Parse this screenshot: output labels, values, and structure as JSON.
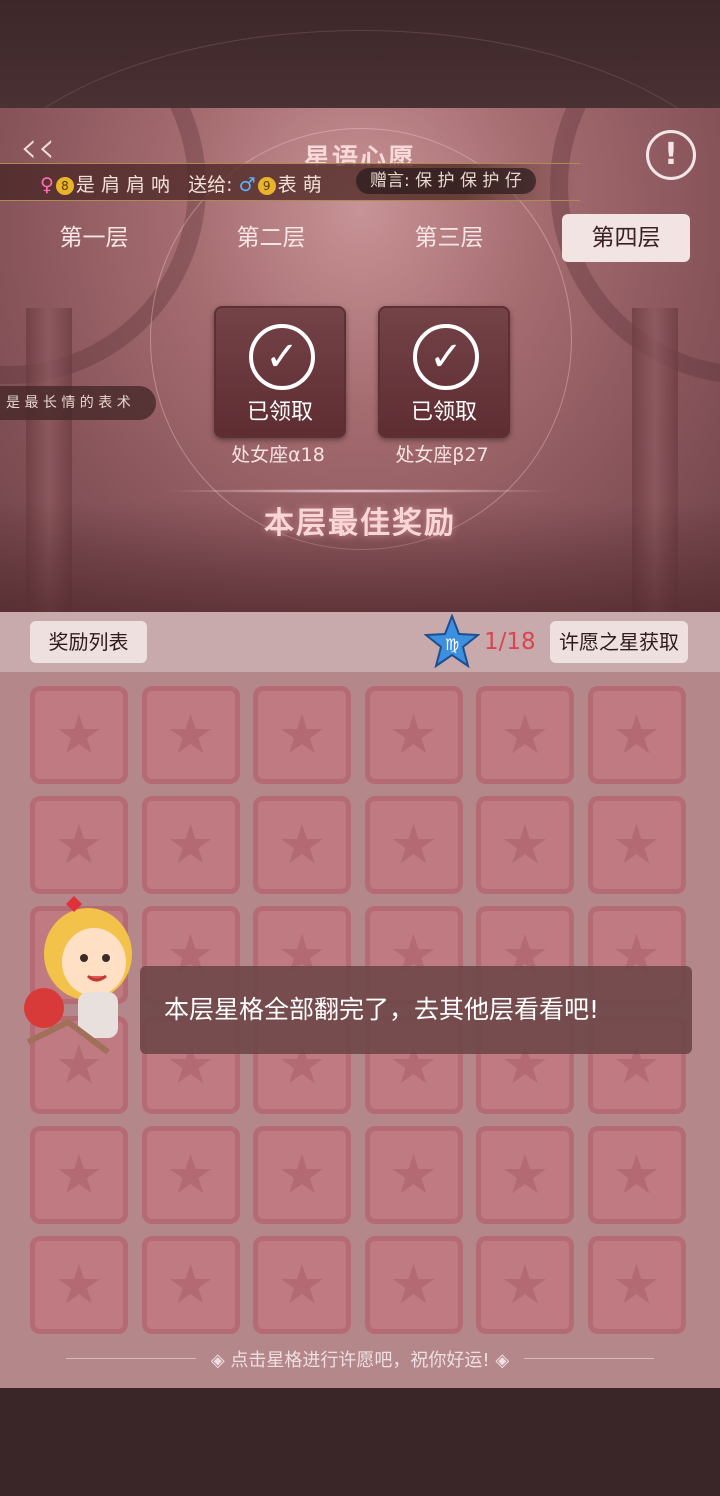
{
  "header": {
    "title": "星语心愿",
    "back_icon": "chevron-left-icon",
    "info_icon": "info-icon"
  },
  "gift_banner": {
    "sender_level": "8",
    "sender_name": "是 肩 肩 呐",
    "sent_to_label": "送给:",
    "receiver_level": "9",
    "receiver_name": "表 萌",
    "message": "赠言: 保 护 保 护 仔"
  },
  "tabs": [
    {
      "label": "第一层",
      "active": false
    },
    {
      "label": "第二层",
      "active": false
    },
    {
      "label": "第三层",
      "active": false
    },
    {
      "label": "第四层",
      "active": true
    }
  ],
  "side_banner": "是 最 长 情 的 表 术",
  "rewards": [
    {
      "status": "已领取",
      "name": "处女座α18"
    },
    {
      "status": "已领取",
      "name": "处女座β27"
    }
  ],
  "reward_section_title": "本层最佳奖励",
  "toolbar": {
    "reward_list_label": "奖励列表",
    "progress": "1/18",
    "progress_color": "#d8454e",
    "get_star_label": "许愿之星获取",
    "star_icon": "virgo-star-icon"
  },
  "grid": {
    "rows": 6,
    "cols": 6,
    "cell_icon": "star-icon"
  },
  "toast": "本层星格全部翻完了，去其他层看看吧!",
  "hint": "点击星格进行许愿吧，祝你好运!"
}
